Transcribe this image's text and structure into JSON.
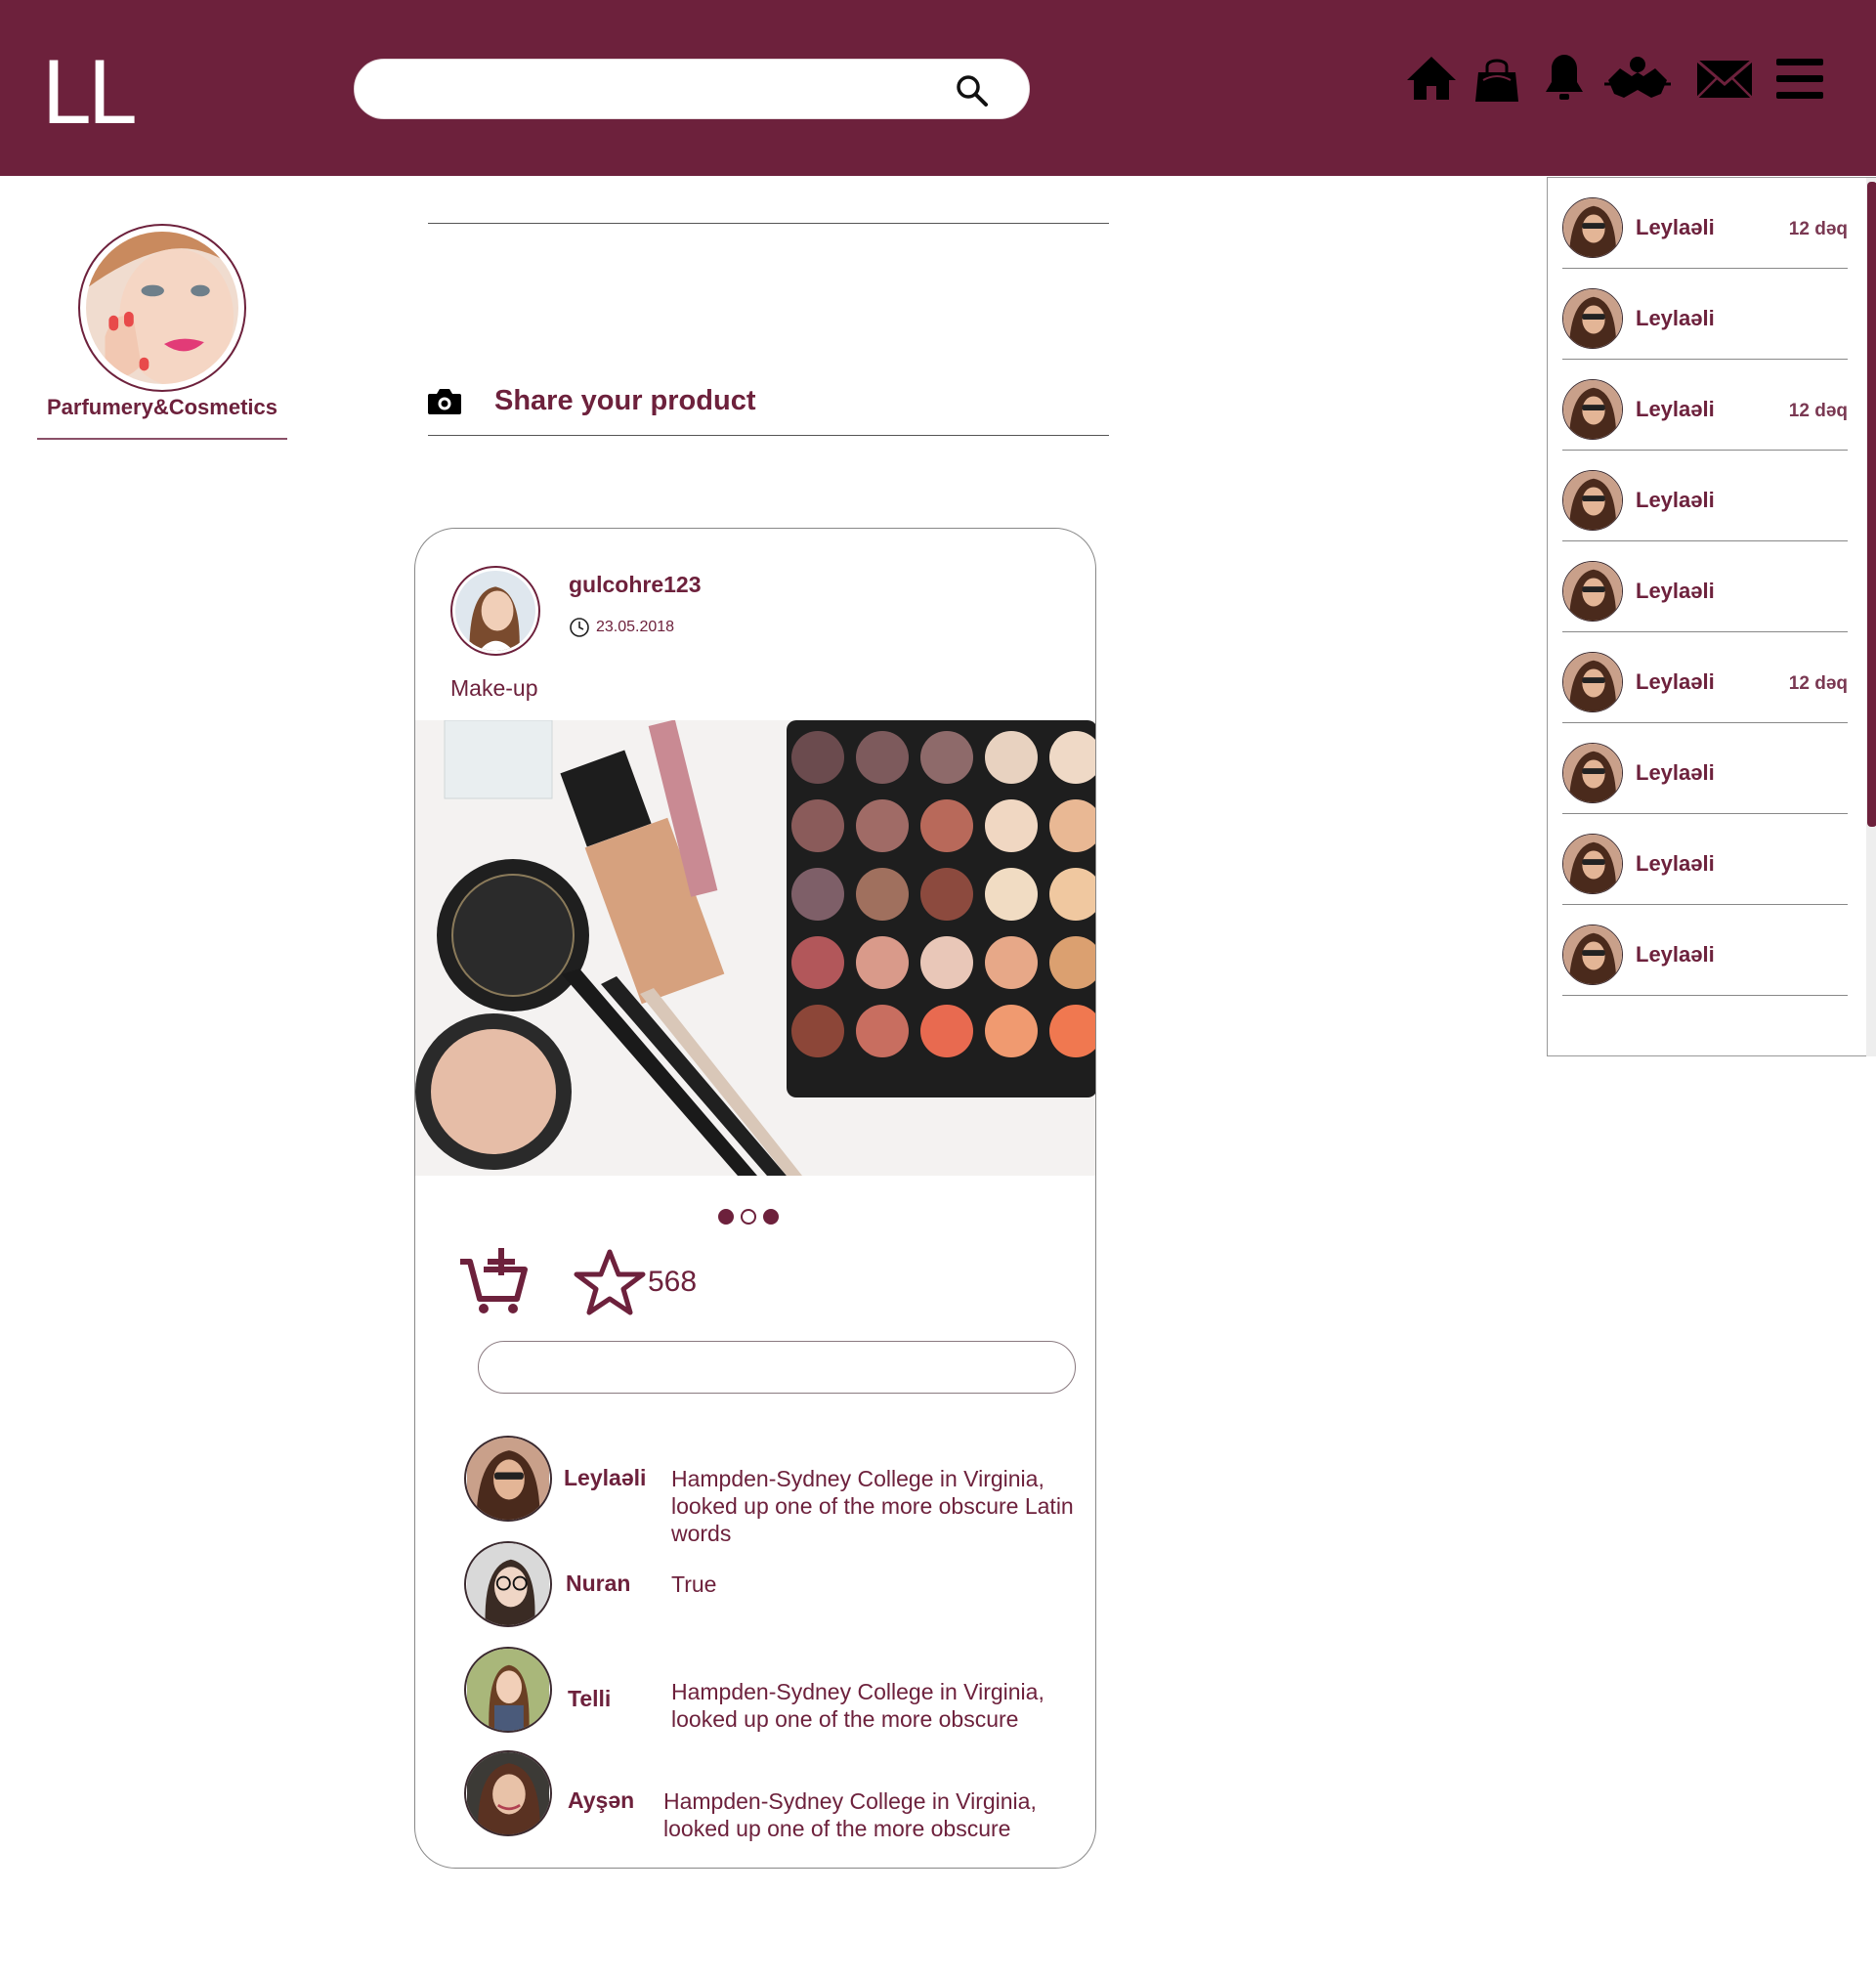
{
  "header": {
    "logo": "LL",
    "search": {
      "value": "",
      "placeholder": ""
    },
    "icons": [
      "home-icon",
      "shopping-bag-icon",
      "bell-icon",
      "friends-icon",
      "mail-icon",
      "menu-icon"
    ]
  },
  "brand": {
    "name": "Parfumery&Cosmetics"
  },
  "share": {
    "label": "Share your product"
  },
  "post": {
    "user": "gulcohre123",
    "date": "23.05.2018",
    "category": "Make-up",
    "likes": "568",
    "carousel": {
      "count": 3,
      "active": 1
    },
    "comment_input": {
      "value": "",
      "placeholder": ""
    },
    "comments": [
      {
        "name": "Leylaəli",
        "text": "Hampden-Sydney College in Virginia, looked up one of the more obscure Latin words"
      },
      {
        "name": "Nuran",
        "text": "True"
      },
      {
        "name": "Telli",
        "text": "Hampden-Sydney College in Virginia, looked up one of the more obscure"
      },
      {
        "name": "Ayşən",
        "text": "Hampden-Sydney College in Virginia, looked up one of the more obscure"
      }
    ]
  },
  "notifications": [
    {
      "name": "Leylaəli",
      "time": "12 dəq"
    },
    {
      "name": "Leylaəli",
      "time": ""
    },
    {
      "name": "Leylaəli",
      "time": "12 dəq"
    },
    {
      "name": "Leylaəli",
      "time": ""
    },
    {
      "name": "Leylaəli",
      "time": ""
    },
    {
      "name": "Leylaəli",
      "time": "12 dəq"
    },
    {
      "name": "Leylaəli",
      "time": ""
    },
    {
      "name": "Leylaəli",
      "time": ""
    },
    {
      "name": "Leylaəli",
      "time": ""
    }
  ],
  "colors": {
    "brand": "#6d213c",
    "background": "#ffffff"
  }
}
